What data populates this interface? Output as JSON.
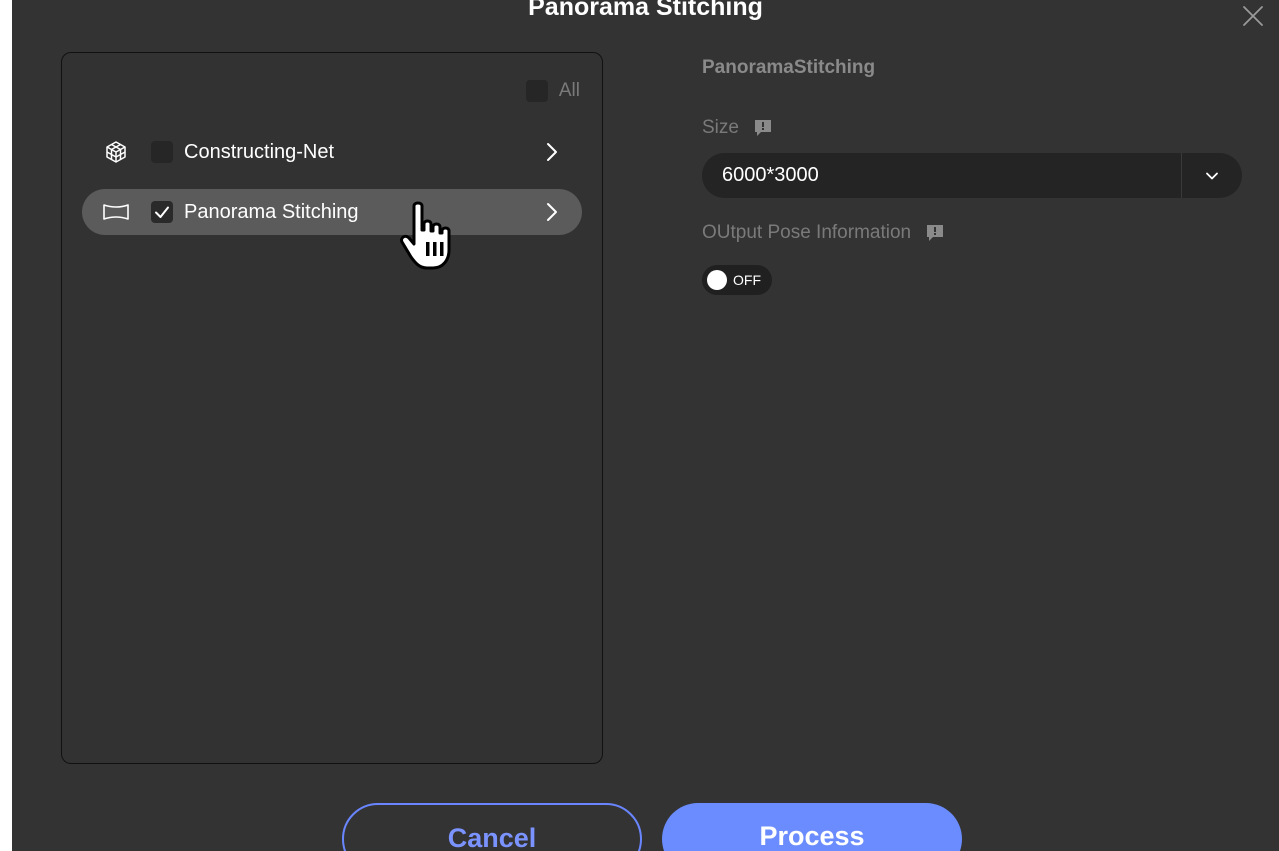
{
  "dialog": {
    "title": "Panorama Stitching",
    "close_icon": "close-icon"
  },
  "task_panel": {
    "all_label": "All",
    "all_checked": false,
    "items": [
      {
        "label": "Constructing-Net",
        "icon": "grid-cube-icon",
        "checked": false,
        "selected": false
      },
      {
        "label": "Panorama Stitching",
        "icon": "panorama-icon",
        "checked": true,
        "selected": true
      }
    ]
  },
  "settings": {
    "section_title": "PanoramaStitching",
    "size_label": "Size",
    "size_value": "6000*3000",
    "output_pose_label": "OUtput Pose Information",
    "output_pose_toggle": "OFF"
  },
  "footer": {
    "cancel_label": "Cancel",
    "process_label": "Process"
  },
  "colors": {
    "background": "#333333",
    "accent": "#6b8cff",
    "selected_row": "#5b5b5b"
  }
}
